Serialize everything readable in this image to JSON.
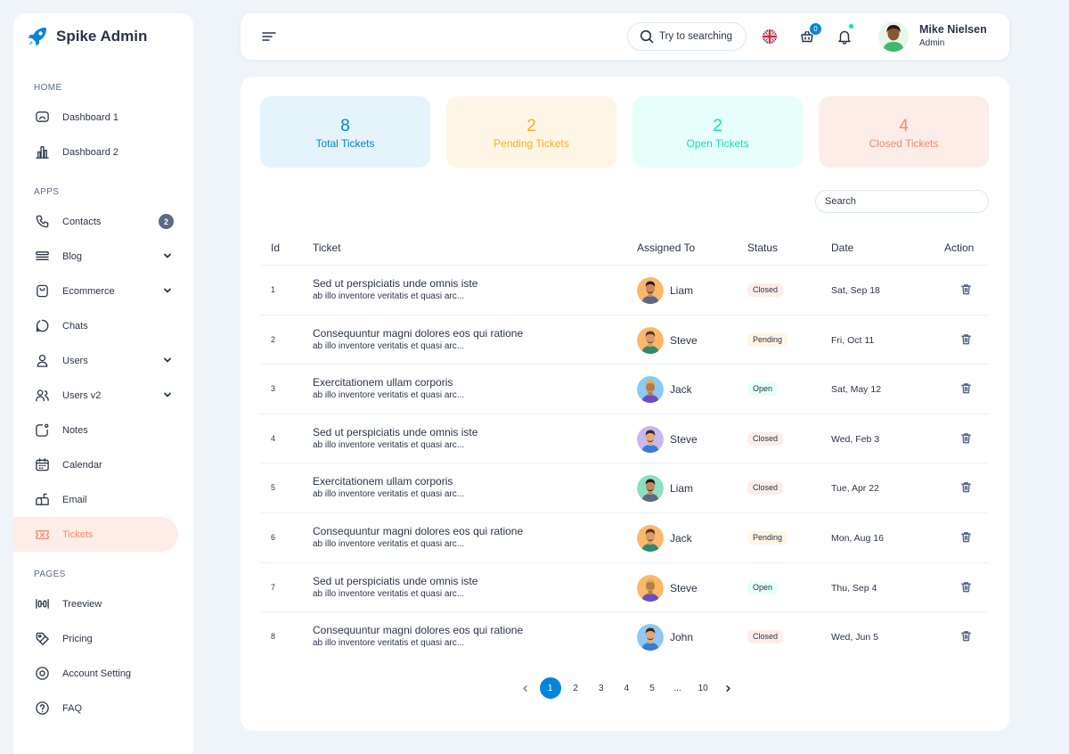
{
  "brand": {
    "name": "Spike Admin"
  },
  "sidebar": {
    "sections": [
      {
        "heading": "HOME",
        "items": [
          {
            "label": "Dashboard 1",
            "icon": "screen-icon"
          },
          {
            "label": "Dashboard 2",
            "icon": "chart-bars-icon"
          }
        ]
      },
      {
        "heading": "APPS",
        "items": [
          {
            "label": "Contacts",
            "icon": "phone-icon",
            "badge": "2"
          },
          {
            "label": "Blog",
            "icon": "blog-icon",
            "has_submenu": true
          },
          {
            "label": "Ecommerce",
            "icon": "basket-icon",
            "has_submenu": true
          },
          {
            "label": "Chats",
            "icon": "chat-icon"
          },
          {
            "label": "Users",
            "icon": "user-icon",
            "has_submenu": true
          },
          {
            "label": "Users v2",
            "icon": "users-icon",
            "has_submenu": true
          },
          {
            "label": "Notes",
            "icon": "note-icon"
          },
          {
            "label": "Calendar",
            "icon": "calendar-icon"
          },
          {
            "label": "Email",
            "icon": "mailbox-icon"
          },
          {
            "label": "Tickets",
            "icon": "ticket-icon",
            "active": true
          }
        ]
      },
      {
        "heading": "PAGES",
        "items": [
          {
            "label": "Treeview",
            "icon": "treeview-icon"
          },
          {
            "label": "Pricing",
            "icon": "tag-icon"
          },
          {
            "label": "Account Setting",
            "icon": "settings-icon"
          },
          {
            "label": "FAQ",
            "icon": "help-icon"
          }
        ]
      }
    ]
  },
  "header": {
    "search_label": "Try to searching",
    "cart_count": "0",
    "user": {
      "name": "Mike Nielsen",
      "role": "Admin"
    }
  },
  "stats": [
    {
      "value": "8",
      "label": "Total Tickets",
      "bg": "#e5f3fb",
      "color": "#0085db"
    },
    {
      "value": "2",
      "label": "Pending Tickets",
      "bg": "#fef5e5",
      "color": "#ffae1f"
    },
    {
      "value": "2",
      "label": "Open Tickets",
      "bg": "#e6fffa",
      "color": "#13deb9"
    },
    {
      "value": "4",
      "label": "Closed Tickets",
      "bg": "#fdede8",
      "color": "#fa896b"
    }
  ],
  "table": {
    "search_placeholder": "Search",
    "columns": {
      "id": "Id",
      "ticket": "Ticket",
      "assigned": "Assigned To",
      "status": "Status",
      "date": "Date",
      "action": "Action"
    },
    "rows": [
      {
        "id": "1",
        "title": "Sed ut perspiciatis unde omnis iste",
        "subtitle": "ab illo inventore veritatis et quasi arc...",
        "assignee": "Liam",
        "avatar_bg": "#fbb86b",
        "status": "Closed",
        "date": "Sat, Sep 18"
      },
      {
        "id": "2",
        "title": "Consequuntur magni dolores eos qui ratione",
        "subtitle": "ab illo inventore veritatis et quasi arc...",
        "assignee": "Steve",
        "avatar_bg": "#fbb86b",
        "status": "Pending",
        "date": "Fri, Oct 11"
      },
      {
        "id": "3",
        "title": "Exercitationem ullam corporis",
        "subtitle": "ab illo inventore veritatis et quasi arc...",
        "assignee": "Jack",
        "avatar_bg": "#8ec9f3",
        "status": "Open",
        "date": "Sat, May 12"
      },
      {
        "id": "4",
        "title": "Sed ut perspiciatis unde omnis iste",
        "subtitle": "ab illo inventore veritatis et quasi arc...",
        "assignee": "Steve",
        "avatar_bg": "#c9b7f2",
        "status": "Closed",
        "date": "Wed, Feb 3"
      },
      {
        "id": "5",
        "title": "Exercitationem ullam corporis",
        "subtitle": "ab illo inventore veritatis et quasi arc...",
        "assignee": "Liam",
        "avatar_bg": "#8be0c4",
        "status": "Closed",
        "date": "Tue, Apr 22"
      },
      {
        "id": "6",
        "title": "Consequuntur magni dolores eos qui ratione",
        "subtitle": "ab illo inventore veritatis et quasi arc...",
        "assignee": "Jack",
        "avatar_bg": "#fbb86b",
        "status": "Pending",
        "date": "Mon, Aug 16"
      },
      {
        "id": "7",
        "title": "Sed ut perspiciatis unde omnis iste",
        "subtitle": "ab illo inventore veritatis et quasi arc...",
        "assignee": "Steve",
        "avatar_bg": "#fbb86b",
        "status": "Open",
        "date": "Thu, Sep 4"
      },
      {
        "id": "8",
        "title": "Consequuntur magni dolores eos qui ratione",
        "subtitle": "ab illo inventore veritatis et quasi arc...",
        "assignee": "John",
        "avatar_bg": "#8ec9f3",
        "status": "Closed",
        "date": "Wed, Jun 5"
      }
    ]
  },
  "pagination": {
    "pages": [
      "1",
      "2",
      "3",
      "4",
      "5",
      "...",
      "10"
    ],
    "current": "1"
  }
}
